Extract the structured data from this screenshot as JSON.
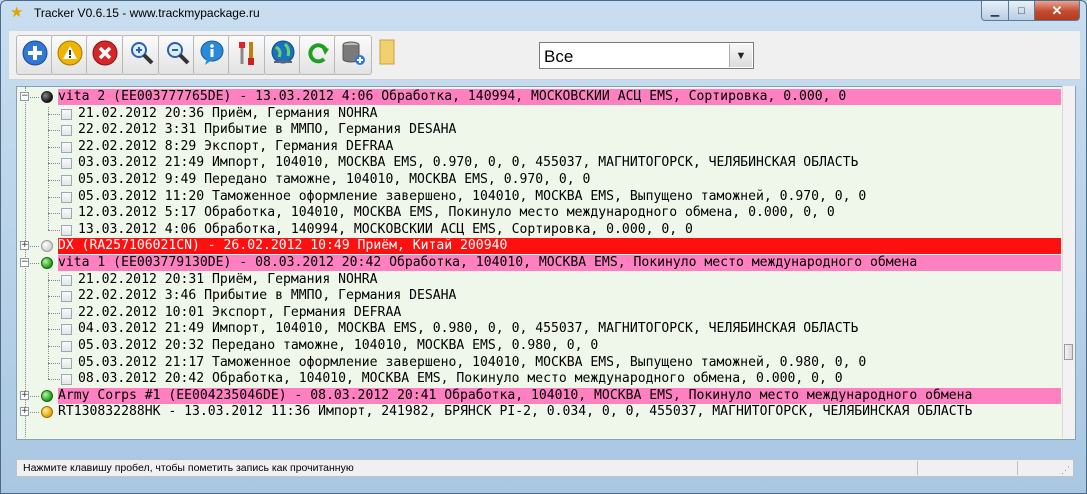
{
  "window": {
    "title": "Tracker V0.6.15 - www.trackmypackage.ru",
    "minimize_label": "▁",
    "maximize_label": "□",
    "close_label": "✕"
  },
  "toolbar": {
    "buttons": [
      {
        "name": "add-button",
        "icon": "plus-circle-icon",
        "color": "#2f78d6"
      },
      {
        "name": "warning-button",
        "icon": "warning-triangle-icon",
        "color": "#f0b400"
      },
      {
        "name": "delete-button",
        "icon": "x-circle-icon",
        "color": "#d42828"
      },
      {
        "name": "zoom-in-button",
        "icon": "zoom-in-icon",
        "color": "#2a60b0"
      },
      {
        "name": "zoom-out-button",
        "icon": "zoom-out-icon",
        "color": "#2a60b0"
      },
      {
        "name": "info-button",
        "icon": "info-bubble-icon",
        "color": "#2a8ad8"
      },
      {
        "name": "settings-button",
        "icon": "tools-icon",
        "color": "#c08010"
      },
      {
        "name": "web-button",
        "icon": "globe-icon",
        "color": "#1c70c0"
      },
      {
        "name": "refresh-button",
        "icon": "refresh-icon",
        "color": "#1ea020"
      },
      {
        "name": "database-button",
        "icon": "database-add-icon",
        "color": "#7a7a7a"
      },
      {
        "name": "note-button",
        "icon": "note-icon",
        "color": "#f0d070"
      }
    ],
    "filter": {
      "value": "Все",
      "arrow": "▼"
    }
  },
  "tree": {
    "rows": [
      {
        "kind": "parent",
        "style": "pink",
        "bullet": "black",
        "text": "vita 2 (EE003777765DE) - 13.03.2012  4:06 Обработка, 140994, МОСКОВСКИЙ АСЦ EMS, Сортировка, 0.000, 0"
      },
      {
        "kind": "child",
        "text": "21.02.2012 20:36 Приём, Германия NOHRA"
      },
      {
        "kind": "child",
        "text": "22.02.2012  3:31 Прибытие в ММПО, Германия DESAHA"
      },
      {
        "kind": "child",
        "text": "22.02.2012  8:29 Экспорт, Германия DEFRAA"
      },
      {
        "kind": "child",
        "text": "03.03.2012 21:49 Импорт, 104010, МОСКВА EMS, 0.970, 0, 0, 455037, МАГНИТОГОРСК, ЧЕЛЯБИНСКАЯ ОБЛАСТЬ"
      },
      {
        "kind": "child",
        "text": "05.03.2012  9:49 Передано таможне, 104010, МОСКВА EMS, 0.970, 0, 0"
      },
      {
        "kind": "child",
        "text": "05.03.2012 11:20 Таможенное оформление завершено, 104010, МОСКВА EMS, Выпущено таможней, 0.970, 0, 0"
      },
      {
        "kind": "child",
        "text": "12.03.2012  5:17 Обработка, 104010, МОСКВА EMS, Покинуло место международного обмена, 0.000, 0, 0"
      },
      {
        "kind": "child",
        "last": true,
        "text": "13.03.2012  4:06 Обработка, 140994, МОСКОВСКИЙ АСЦ EMS, Сортировка, 0.000, 0, 0"
      },
      {
        "kind": "parent",
        "style": "red",
        "bullet": "grey",
        "text": "DX (RA257106021CN) - 26.02.2012 10:49 Приём, Китай 200940"
      },
      {
        "kind": "parent",
        "style": "pink",
        "bullet": "green",
        "text": " vita 1 (EE003779130DE) - 08.03.2012 20:42 Обработка, 104010, МОСКВА EMS, Покинуло место международного обмена"
      },
      {
        "kind": "child",
        "text": "21.02.2012 20:31 Приём, Германия NOHRA"
      },
      {
        "kind": "child",
        "text": "22.02.2012  3:46 Прибытие в ММПО, Германия DESAHA"
      },
      {
        "kind": "child",
        "text": "22.02.2012 10:01 Экспорт, Германия DEFRAA"
      },
      {
        "kind": "child",
        "text": "04.03.2012 21:49 Импорт, 104010, МОСКВА EMS, 0.980, 0, 0, 455037, МАГНИТОГОРСК, ЧЕЛЯБИНСКАЯ ОБЛАСТЬ"
      },
      {
        "kind": "child",
        "text": "05.03.2012 20:32 Передано таможне, 104010, МОСКВА EMS, 0.980, 0, 0"
      },
      {
        "kind": "child",
        "text": "05.03.2012 21:17 Таможенное оформление завершено, 104010, МОСКВА EMS, Выпущено таможней, 0.980, 0, 0"
      },
      {
        "kind": "child",
        "last": true,
        "text": "08.03.2012 20:42 Обработка, 104010, МОСКВА EMS, Покинуло место международного обмена, 0.000, 0, 0"
      },
      {
        "kind": "parent",
        "style": "pink",
        "bullet": "green",
        "text": "Army Corps #1 (EE004235046DE) - 08.03.2012 20:41 Обработка, 104010, МОСКВА EMS, Покинуло место международного обмена"
      },
      {
        "kind": "parent",
        "style": "none",
        "bullet": "yellow",
        "text": "RT130832288HK - 13.03.2012 11:36 Импорт, 241982, БРЯНСК PI-2, 0.034, 0, 0, 455037, МАГНИТОГОРСК, ЧЕЛЯБИНСКАЯ ОБЛАСТЬ"
      }
    ]
  },
  "statusbar": {
    "text": "Нажмите клавишу пробел, чтобы пометить запись как прочитанную"
  }
}
